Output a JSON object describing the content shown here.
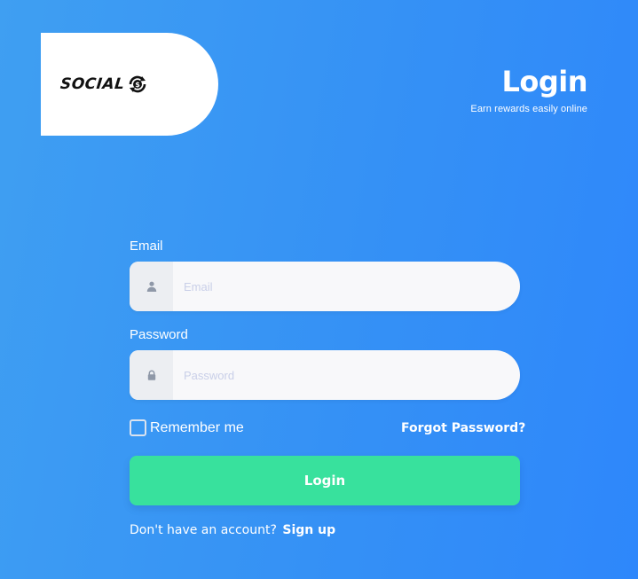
{
  "logo": {
    "text": "SOCIAL",
    "mark_symbol": "$",
    "icon": "coin-refresh-icon"
  },
  "header": {
    "title": "Login",
    "subtitle": "Earn rewards easily online"
  },
  "form": {
    "email": {
      "label": "Email",
      "placeholder": "Email",
      "value": "",
      "icon": "user-icon"
    },
    "password": {
      "label": "Password",
      "placeholder": "Password",
      "value": "",
      "icon": "lock-icon"
    },
    "remember_label": "Remember me",
    "remember_checked": false,
    "forgot_label": "Forgot Password?",
    "login_label": "Login",
    "signup_prompt": "Don't have an account?",
    "signup_label": "Sign up"
  },
  "colors": {
    "background_start": "#3f9ff2",
    "background_end": "#2e87fb",
    "button": "#38e19d",
    "input_bg": "#f8f8fa",
    "icon_box_bg": "#eceef2",
    "placeholder": "#c9cfe8"
  }
}
